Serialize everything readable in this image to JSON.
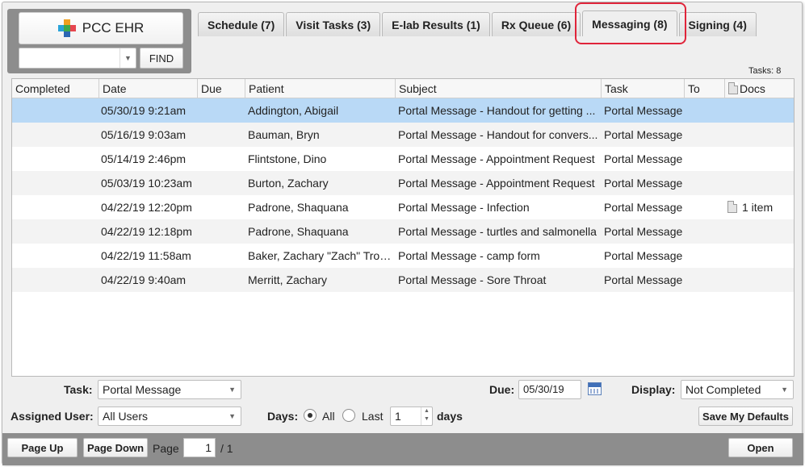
{
  "logo": {
    "title": "PCC EHR",
    "find_label": "FIND",
    "find_value": ""
  },
  "tabs": [
    {
      "label": "Schedule (7)"
    },
    {
      "label": "Visit Tasks (3)"
    },
    {
      "label": "E-lab Results (1)"
    },
    {
      "label": "Rx Queue (6)"
    },
    {
      "label": "Messaging (8)"
    },
    {
      "label": "Signing (4)"
    }
  ],
  "active_tab": "Messaging (8)",
  "highlight_color": "#e0243a",
  "tasks_count": "Tasks:  8",
  "table": {
    "columns": [
      "Completed",
      "Date",
      "Due",
      "Patient",
      "Subject",
      "Task",
      "To",
      "Docs"
    ],
    "rows": [
      {
        "completed": "",
        "date": "05/30/19 9:21am",
        "due": "",
        "patient": "Addington, Abigail",
        "subject": "Portal Message - Handout for getting ...",
        "task": "Portal Message",
        "to": "",
        "docs": ""
      },
      {
        "completed": "",
        "date": "05/16/19 9:03am",
        "due": "",
        "patient": "Bauman, Bryn",
        "subject": "Portal Message - Handout for convers...",
        "task": "Portal Message",
        "to": "",
        "docs": ""
      },
      {
        "completed": "",
        "date": "05/14/19 2:46pm",
        "due": "",
        "patient": "Flintstone, Dino",
        "subject": "Portal Message - Appointment Request",
        "task": "Portal Message",
        "to": "",
        "docs": ""
      },
      {
        "completed": "",
        "date": "05/03/19 10:23am",
        "due": "",
        "patient": "Burton, Zachary",
        "subject": "Portal Message - Appointment Request",
        "task": "Portal Message",
        "to": "",
        "docs": ""
      },
      {
        "completed": "",
        "date": "04/22/19 12:20pm",
        "due": "",
        "patient": "Padrone, Shaquana",
        "subject": "Portal Message - Infection",
        "task": "Portal Message",
        "to": "",
        "docs": "1 item"
      },
      {
        "completed": "",
        "date": "04/22/19 12:18pm",
        "due": "",
        "patient": "Padrone, Shaquana",
        "subject": "Portal Message - turtles and salmonella",
        "task": "Portal Message",
        "to": "",
        "docs": ""
      },
      {
        "completed": "",
        "date": "04/22/19 11:58am",
        "due": "",
        "patient": "Baker, Zachary \"Zach\" Troy Jr",
        "subject": "Portal Message - camp form",
        "task": "Portal Message",
        "to": "",
        "docs": ""
      },
      {
        "completed": "",
        "date": "04/22/19 9:40am",
        "due": "",
        "patient": "Merritt, Zachary",
        "subject": "Portal Message - Sore Throat",
        "task": "Portal Message",
        "to": "",
        "docs": ""
      }
    ],
    "selected_row_color": "#b9d9f6"
  },
  "filters": {
    "task_label": "Task:",
    "task_value": "Portal Message",
    "due_label": "Due:",
    "due_value": "05/30/19",
    "display_label": "Display:",
    "display_value": "Not Completed",
    "assigned_label": "Assigned User:",
    "assigned_value": "All Users",
    "days_label": "Days:",
    "days_all": "All",
    "days_last": "Last",
    "days_value": "1",
    "days_unit": "days",
    "save_defaults": "Save My Defaults"
  },
  "footer": {
    "page_up": "Page Up",
    "page_down": "Page Down",
    "page_label": "Page",
    "page_value": "1",
    "page_total": "/ 1",
    "open": "Open"
  }
}
